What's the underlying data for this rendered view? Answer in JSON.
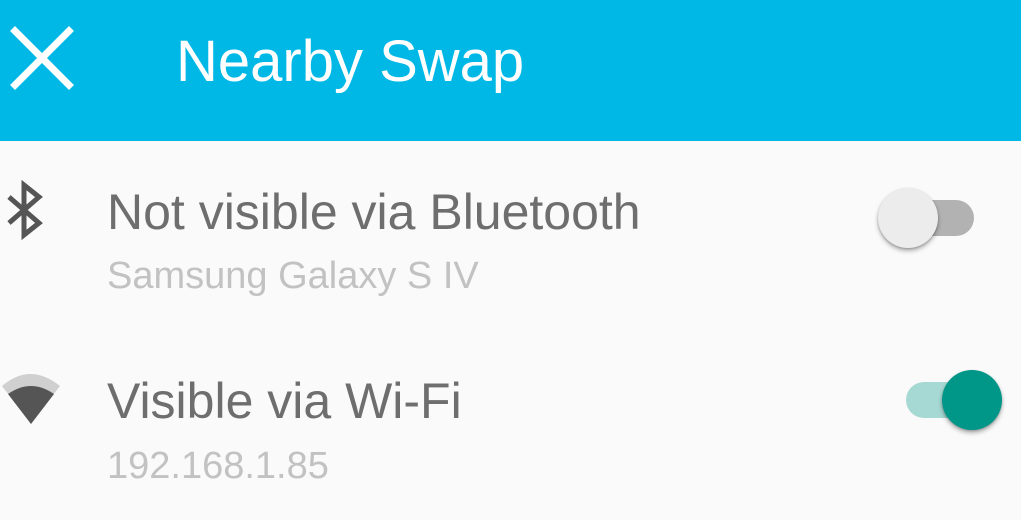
{
  "toolbar": {
    "title": "Nearby Swap",
    "close_icon": "close-icon",
    "background_color": "#00b8e6"
  },
  "bluetooth": {
    "icon": "bluetooth-icon",
    "title": "Not visible via Bluetooth",
    "subtitle": "Samsung Galaxy S IV",
    "toggle_on": false
  },
  "wifi": {
    "icon": "wifi-icon",
    "title": "Visible via Wi-Fi",
    "subtitle": "192.168.1.85",
    "toggle_on": true,
    "accent_color": "#009688"
  }
}
